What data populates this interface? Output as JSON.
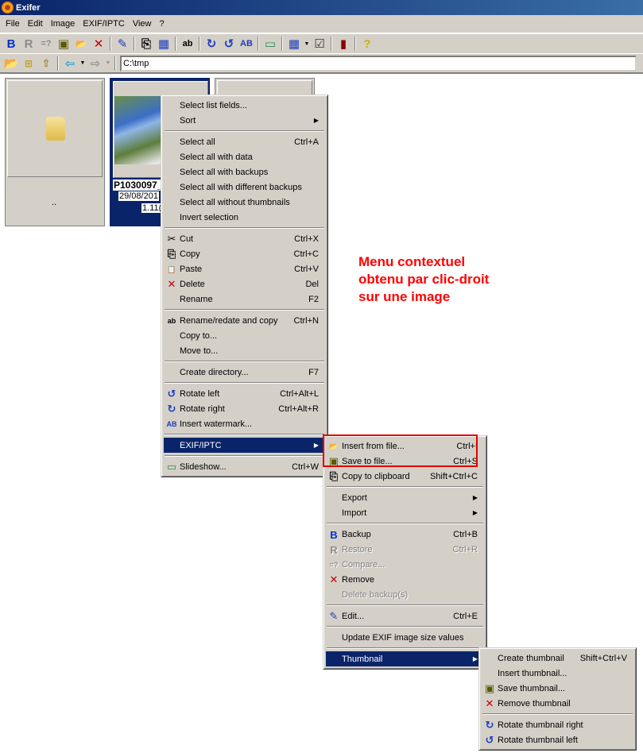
{
  "window": {
    "title": "Exifer"
  },
  "menubar": [
    "File",
    "Edit",
    "Image",
    "EXIF/IPTC",
    "View",
    "?"
  ],
  "toolbar1": [
    {
      "icon": "backup-icon",
      "glyph": "B",
      "color": "#0033cc"
    },
    {
      "icon": "restore-icon",
      "glyph": "R",
      "color": "#8a8a8a"
    },
    {
      "icon": "compare-icon",
      "glyph": "=?",
      "color": "#8a8a8a"
    },
    {
      "icon": "save-icon",
      "glyph": "▣",
      "color": "#5a5a00"
    },
    {
      "icon": "open-folder-icon",
      "glyph": "📂",
      "color": "#a08020"
    },
    {
      "icon": "delete-icon",
      "glyph": "✕",
      "color": "#c00000"
    },
    {
      "icon": "edit-icon",
      "glyph": "✎",
      "color": "#1a3cc0"
    },
    {
      "icon": "copy-icon",
      "glyph": "⎘",
      "color": "#000"
    },
    {
      "icon": "list-fields-icon",
      "glyph": "▦",
      "color": "#1a3cc0"
    },
    {
      "icon": "rename-icon",
      "glyph": "ab",
      "color": "#000"
    },
    {
      "icon": "rotate-right-icon",
      "glyph": "↻",
      "color": "#1a3cc0"
    },
    {
      "icon": "rotate-left-icon",
      "glyph": "↺",
      "color": "#1a3cc0"
    },
    {
      "icon": "watermark-icon",
      "glyph": "AB",
      "color": "#1a3cc0"
    },
    {
      "icon": "slideshow-icon",
      "glyph": "▭",
      "color": "#2a8a5a"
    },
    {
      "icon": "view-mode-icon",
      "glyph": "▦",
      "color": "#1a3cc0"
    },
    {
      "icon": "select-icon",
      "glyph": "☑",
      "color": "#333"
    },
    {
      "icon": "exit-icon",
      "glyph": "▮",
      "color": "#8b0000"
    },
    {
      "icon": "help-icon",
      "glyph": "?",
      "color": "#d4b000"
    }
  ],
  "address": {
    "path": "C:\\tmp"
  },
  "files": [
    {
      "type": "folder",
      "label": ".."
    },
    {
      "type": "image",
      "name": "P1030097_",
      "date": "29/08/201",
      "size": "1.11("
    },
    {
      "type": "image",
      "name": "",
      "date": "",
      "size": ""
    }
  ],
  "annotation": "Menu contextuel\nobtenu par clic-droit\nsur une image",
  "context_menu": {
    "groups": [
      [
        {
          "label": "Select list fields...",
          "shortcut": ""
        },
        {
          "label": "Sort",
          "shortcut": "",
          "submenu": true
        }
      ],
      [
        {
          "label": "Select all",
          "shortcut": "Ctrl+A"
        },
        {
          "label": "Select all with data",
          "shortcut": ""
        },
        {
          "label": "Select all with backups",
          "shortcut": ""
        },
        {
          "label": "Select all with different backups",
          "shortcut": ""
        },
        {
          "label": "Select all without thumbnails",
          "shortcut": ""
        },
        {
          "label": "Invert selection",
          "shortcut": ""
        }
      ],
      [
        {
          "label": "Cut",
          "shortcut": "Ctrl+X",
          "icon": "scissors-icon",
          "glyph": "✂",
          "color": "#000"
        },
        {
          "label": "Copy",
          "shortcut": "Ctrl+C",
          "icon": "copy-icon",
          "glyph": "⎘",
          "color": "#000"
        },
        {
          "label": "Paste",
          "shortcut": "Ctrl+V",
          "icon": "paste-icon",
          "glyph": "📋",
          "color": "#8a6a20"
        },
        {
          "label": "Delete",
          "shortcut": "Del",
          "icon": "delete-icon",
          "glyph": "✕",
          "color": "#c00000"
        },
        {
          "label": "Rename",
          "shortcut": "F2"
        }
      ],
      [
        {
          "label": "Rename/redate and copy",
          "shortcut": "Ctrl+N",
          "icon": "rename-icon",
          "glyph": "ab",
          "color": "#000"
        },
        {
          "label": "Copy to...",
          "shortcut": ""
        },
        {
          "label": "Move to...",
          "shortcut": ""
        }
      ],
      [
        {
          "label": "Create directory...",
          "shortcut": "F7"
        }
      ],
      [
        {
          "label": "Rotate left",
          "shortcut": "Ctrl+Alt+L",
          "icon": "rotate-left-icon",
          "glyph": "↺",
          "color": "#1a3cc0"
        },
        {
          "label": "Rotate right",
          "shortcut": "Ctrl+Alt+R",
          "icon": "rotate-right-icon",
          "glyph": "↻",
          "color": "#1a3cc0"
        },
        {
          "label": "Insert watermark...",
          "shortcut": "",
          "icon": "watermark-icon",
          "glyph": "AB",
          "color": "#1a3cc0"
        }
      ],
      [
        {
          "label": "EXIF/IPTC",
          "shortcut": "",
          "submenu": true,
          "active": true
        }
      ],
      [
        {
          "label": "Slideshow...",
          "shortcut": "Ctrl+W",
          "icon": "slideshow-icon",
          "glyph": "▭",
          "color": "#2a8a5a"
        }
      ]
    ]
  },
  "exif_submenu": {
    "groups": [
      [
        {
          "label": "Insert from file...",
          "shortcut": "Ctrl+I",
          "icon": "open-folder-icon",
          "glyph": "📂",
          "color": "#a08020"
        },
        {
          "label": "Save to file...",
          "shortcut": "Ctrl+S",
          "icon": "save-icon",
          "glyph": "▣",
          "color": "#5a5a00"
        },
        {
          "label": "Copy to clipboard",
          "shortcut": "Shift+Ctrl+C",
          "icon": "copy-icon",
          "glyph": "⎘",
          "color": "#000"
        }
      ],
      [
        {
          "label": "Export",
          "shortcut": "",
          "submenu": true
        },
        {
          "label": "Import",
          "shortcut": "",
          "submenu": true
        }
      ],
      [
        {
          "label": "Backup",
          "shortcut": "Ctrl+B",
          "icon": "backup-icon",
          "glyph": "B",
          "color": "#0033cc"
        },
        {
          "label": "Restore",
          "shortcut": "Ctrl+R",
          "icon": "restore-icon",
          "glyph": "R",
          "color": "#8a8a8a",
          "disabled": true
        },
        {
          "label": "Compare...",
          "shortcut": "",
          "icon": "compare-icon",
          "glyph": "=?",
          "color": "#8a8a8a",
          "disabled": true
        },
        {
          "label": "Remove",
          "shortcut": "",
          "icon": "remove-icon",
          "glyph": "✕",
          "color": "#c00000"
        },
        {
          "label": "Delete backup(s)",
          "shortcut": "",
          "disabled": true
        }
      ],
      [
        {
          "label": "Edit...",
          "shortcut": "Ctrl+E",
          "icon": "edit-icon",
          "glyph": "✎",
          "color": "#1a3cc0"
        }
      ],
      [
        {
          "label": "Update EXIF image size values",
          "shortcut": ""
        }
      ],
      [
        {
          "label": "Thumbnail",
          "shortcut": "",
          "submenu": true,
          "active": true
        }
      ]
    ]
  },
  "thumbnail_submenu": {
    "groups": [
      [
        {
          "label": "Create thumbnail",
          "shortcut": "Shift+Ctrl+V"
        },
        {
          "label": "Insert thumbnail...",
          "shortcut": ""
        },
        {
          "label": "Save thumbnail...",
          "shortcut": "",
          "icon": "save-icon",
          "glyph": "▣",
          "color": "#5a5a00"
        },
        {
          "label": "Remove thumbnail",
          "shortcut": "",
          "icon": "remove-icon",
          "glyph": "✕",
          "color": "#c00000"
        }
      ],
      [
        {
          "label": "Rotate thumbnail right",
          "shortcut": "",
          "icon": "rotate-right-icon",
          "glyph": "↻",
          "color": "#1a3cc0"
        },
        {
          "label": "Rotate thumbnail left",
          "shortcut": "",
          "icon": "rotate-left-icon",
          "glyph": "↺",
          "color": "#1a3cc0"
        }
      ]
    ]
  },
  "highlight_color": "#e00000"
}
